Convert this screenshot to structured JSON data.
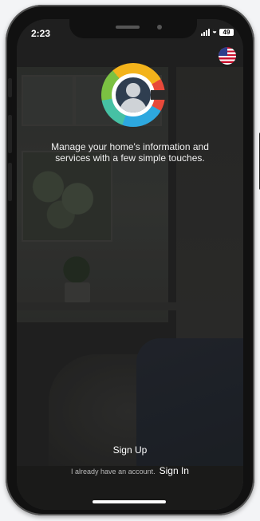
{
  "status_bar": {
    "time": "2:23",
    "battery": "49"
  },
  "app": {
    "tagline": "Manage your home's information and services with a few simple touches.",
    "signup_label": "Sign Up",
    "account_prompt": "I already have an account.",
    "signin_label": "Sign In"
  },
  "icons": [
    "us-flag-icon",
    "app-logo",
    "signal-icon",
    "wifi-icon",
    "battery-icon"
  ]
}
